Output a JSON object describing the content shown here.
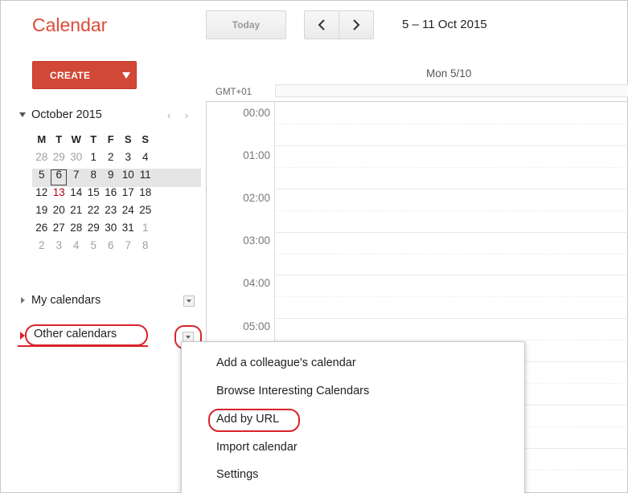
{
  "header": {
    "brand": "Calendar",
    "today_label": "Today",
    "date_range": "5 – 11 Oct 2015"
  },
  "create": {
    "label": "CREATE"
  },
  "mini_calendar": {
    "month_label": "October 2015",
    "prev": "‹",
    "next": "›",
    "weekdays": [
      "M",
      "T",
      "W",
      "T",
      "F",
      "S",
      "S"
    ],
    "weeks": [
      [
        "28",
        "29",
        "30",
        "1",
        "2",
        "3",
        "4"
      ],
      [
        "5",
        "6",
        "7",
        "8",
        "9",
        "10",
        "11"
      ],
      [
        "12",
        "13",
        "14",
        "15",
        "16",
        "17",
        "18"
      ],
      [
        "19",
        "20",
        "21",
        "22",
        "23",
        "24",
        "25"
      ],
      [
        "26",
        "27",
        "28",
        "29",
        "30",
        "31",
        "1"
      ],
      [
        "2",
        "3",
        "4",
        "5",
        "6",
        "7",
        "8"
      ]
    ],
    "today": "6"
  },
  "sidebar": {
    "my_calendars": "My calendars",
    "other_calendars": "Other calendars"
  },
  "main": {
    "timezone": "GMT+01",
    "day_header": "Mon 5/10",
    "hours": [
      "00:00",
      "01:00",
      "02:00",
      "03:00",
      "04:00",
      "05:00"
    ]
  },
  "menu": {
    "items": [
      "Add a colleague's calendar",
      "Browse Interesting Calendars",
      "Add by URL",
      "Import calendar",
      "Settings"
    ]
  },
  "colors": {
    "brand": "#dd4b39",
    "create_bg": "#d14836",
    "annotation": "#d9232a"
  }
}
